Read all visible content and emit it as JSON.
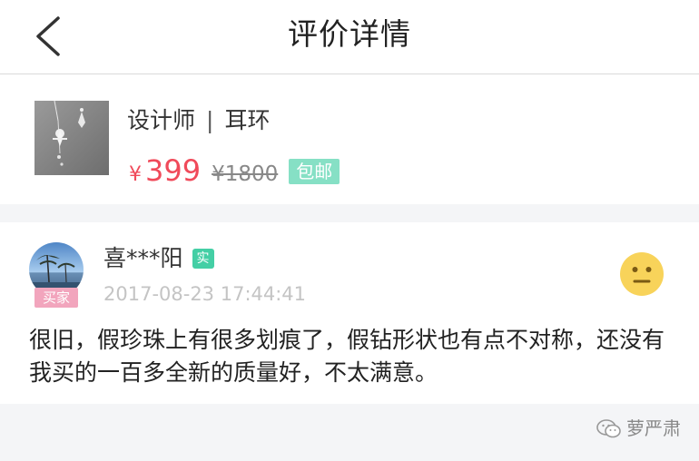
{
  "header": {
    "back_icon": "chevron-left-icon",
    "title": "评价详情"
  },
  "product": {
    "name_left": "设计师",
    "name_right": "耳环",
    "currency": "¥",
    "price": "399",
    "original_price": "¥1800",
    "shipping_badge": "包邮",
    "colors": {
      "price": "#f04a5a",
      "badge": "#86e0c5"
    }
  },
  "review": {
    "username": "喜***阳",
    "verified_badge": "实",
    "buyer_tag": "买家",
    "timestamp": "2017-08-23 17:44:41",
    "mood_icon": "neutral-face-icon",
    "text": "很旧，假珍珠上有很多划痕了，假钻形状也有点不对称，还没有我买的一百多全新的质量好，不太满意。"
  },
  "watermark": {
    "icon": "wechat-icon",
    "text": "萝严肃"
  }
}
